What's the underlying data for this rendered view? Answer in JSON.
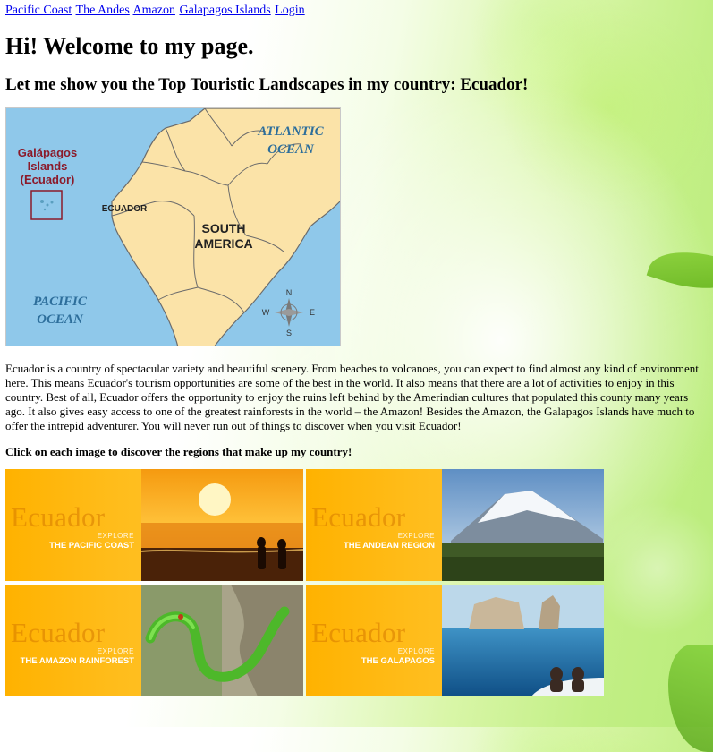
{
  "nav": {
    "links": [
      "Pacific Coast",
      "The Andes",
      "Amazon",
      "Galapagos Islands",
      "Login"
    ]
  },
  "heading": "Hi! Welcome to my page.",
  "subheading": "Let me show you the Top Touristic Landscapes in my country: Ecuador!",
  "map": {
    "ocean_atlantic": [
      "ATLANTIC",
      "OCEAN"
    ],
    "ocean_pacific": [
      "PACIFIC",
      "OCEAN"
    ],
    "galapagos": [
      "Galápagos",
      "Islands",
      "(Ecuador)"
    ],
    "country": "ECUADOR",
    "continent": [
      "SOUTH",
      "AMERICA"
    ],
    "compass": {
      "n": "N",
      "s": "S",
      "e": "E",
      "w": "W"
    }
  },
  "intro": "Ecuador is a country of spectacular variety and beautiful scenery. From beaches to volcanoes, you can expect to find almost any kind of environment here. This means Ecuador's tourism opportunities are some of the best in the world. It also means that there are a lot of activities to enjoy in this country. Best of all, Ecuador offers the opportunity to enjoy the ruins left behind by the Amerindian cultures that populated this county many years ago. It also gives easy access to one of the greatest rainforests in the world – the Amazon! Besides the Amazon, the Galapagos Islands have much to offer the intrepid adventurer. You will never run out of things to discover when you visit Ecuador!",
  "cta": "Click on each image to discover the regions that make up my country!",
  "tiles": [
    {
      "brand": "Ecuador",
      "explore": "EXPLORE",
      "region": "THE PACIFIC COAST"
    },
    {
      "brand": "Ecuador",
      "explore": "EXPLORE",
      "region": "THE ANDEAN REGION"
    },
    {
      "brand": "Ecuador",
      "explore": "EXPLORE",
      "region": "THE AMAZON RAINFOREST"
    },
    {
      "brand": "Ecuador",
      "explore": "EXPLORE",
      "region": "THE GALAPAGOS"
    }
  ],
  "colors": {
    "link": "#0000ee",
    "tile_orange": "#ffb200",
    "ocean": "#8fc8ea",
    "land": "#fbe3a8",
    "background_green": "#c2ef85"
  }
}
